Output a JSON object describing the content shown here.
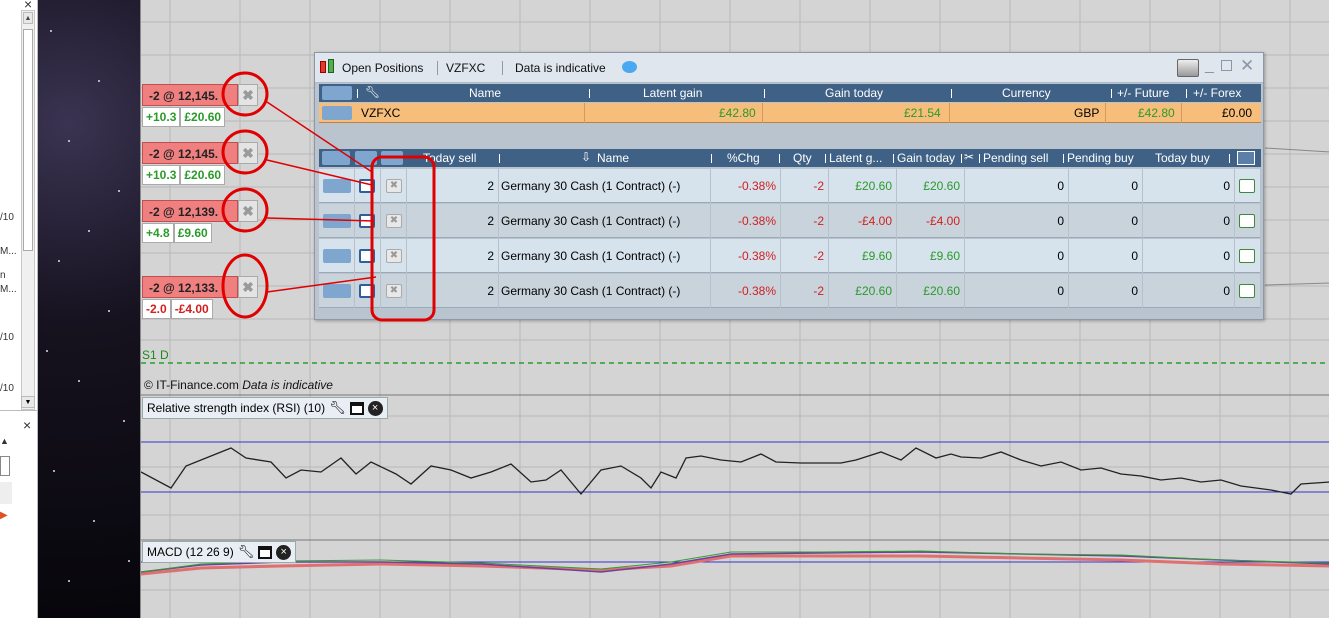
{
  "left_panel": {
    "close": "×",
    "items": [
      "/10",
      "M...",
      "n",
      "M...",
      "/10",
      "/10"
    ],
    "close2": "×"
  },
  "order_tags": [
    {
      "price": "-2 @ 12,145.",
      "points": "+10.3",
      "money": "£20.60",
      "points_status": "positive",
      "money_status": "positive"
    },
    {
      "price": "-2 @ 12,145.",
      "points": "+10.3",
      "money": "£20.60",
      "points_status": "positive",
      "money_status": "positive"
    },
    {
      "price": "-2 @ 12,139.",
      "points": "+4.8",
      "money": "£9.60",
      "points_status": "positive",
      "money_status": "positive"
    },
    {
      "price": "-2 @ 12,133.",
      "points": "-2.0",
      "money": "-£4.00",
      "points_status": "negative",
      "money_status": "negative"
    }
  ],
  "window": {
    "title": "Open Positions",
    "account": "VZFXC",
    "indicative": "Data is indicative",
    "summary_headers": [
      "Name",
      "Latent gain",
      "Gain today",
      "Currency",
      "+/- Future",
      "+/- Forex"
    ],
    "summary_row": {
      "name": "VZFXC",
      "latent_gain": "£42.80",
      "gain_today": "£21.54",
      "currency": "GBP",
      "future": "£42.80",
      "forex": "£0.00"
    },
    "detail_headers": [
      "Today sell",
      "Name",
      "%Chg",
      "Qty",
      "Latent g...",
      "Gain today",
      "Pending sell",
      "Pending buy",
      "Today buy"
    ],
    "rows": [
      {
        "today_sell": "2",
        "name": "Germany 30 Cash (1 Contract) (-)",
        "chg": "-0.38%",
        "qty": "-2",
        "latent": "£20.60",
        "gain_today": "£20.60",
        "pending_sell": "0",
        "pending_buy": "0",
        "today_buy": "0"
      },
      {
        "today_sell": "2",
        "name": "Germany 30 Cash (1 Contract) (-)",
        "chg": "-0.38%",
        "qty": "-2",
        "latent": "-£4.00",
        "gain_today": "-£4.00",
        "pending_sell": "0",
        "pending_buy": "0",
        "today_buy": "0"
      },
      {
        "today_sell": "2",
        "name": "Germany 30 Cash (1 Contract) (-)",
        "chg": "-0.38%",
        "qty": "-2",
        "latent": "£9.60",
        "gain_today": "£9.60",
        "pending_sell": "0",
        "pending_buy": "0",
        "today_buy": "0"
      },
      {
        "today_sell": "2",
        "name": "Germany 30 Cash (1 Contract) (-)",
        "chg": "-0.38%",
        "qty": "-2",
        "latent": "£20.60",
        "gain_today": "£20.60",
        "pending_sell": "0",
        "pending_buy": "0",
        "today_buy": "0"
      }
    ]
  },
  "chart": {
    "s1_label": "S1 D",
    "copyright": "© IT-Finance.com",
    "indicative": "Data is indicative",
    "rsi_label": "Relative strength index (RSI) (10)",
    "macd_label": "MACD (12 26 9)"
  },
  "colors": {
    "order_red": "#f08080",
    "positive": "#2a9a2a",
    "negative": "#d02020",
    "header_blue": "#3f6185",
    "summary_orange": "#f6be7a",
    "annotation_red": "#e00000"
  }
}
